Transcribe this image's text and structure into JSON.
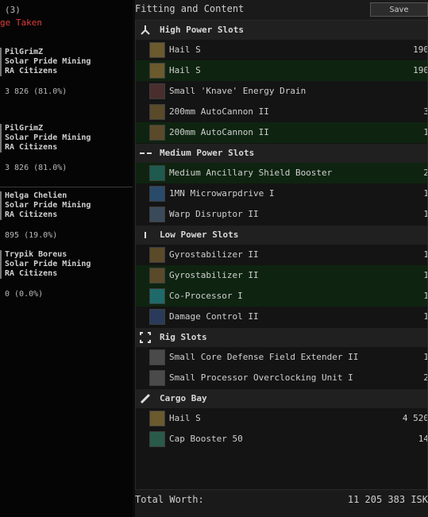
{
  "left_panel": {
    "count": "(3)",
    "damage_label": "ge Taken",
    "entries": [
      {
        "name": "PilGrimZ",
        "corp": "Solar Pride Mining",
        "alliance": "RA Citizens",
        "value": "3 826 (81.0%)"
      },
      {
        "name": "PilGrimZ",
        "corp": "Solar Pride Mining",
        "alliance": "RA Citizens",
        "value": "3 826 (81.0%)"
      },
      {
        "name": "Helga Chelien",
        "corp": "Solar Pride Mining",
        "alliance": "RA Citizens",
        "value": "895 (19.0%)"
      },
      {
        "name": "Trypik Boreus",
        "corp": "Solar Pride Mining",
        "alliance": "RA Citizens",
        "value": "0 (0.0%)"
      }
    ]
  },
  "panel": {
    "title": "Fitting and Content",
    "save_button": "Save Fitting",
    "sections": [
      {
        "label": "High Power Slots",
        "icon": "high-slot-icon",
        "items": [
          {
            "name": "Hail S",
            "qty": "190",
            "icon": "ammo-icon",
            "alt": false
          },
          {
            "name": "Hail S",
            "qty": "190",
            "icon": "ammo-icon",
            "alt": true
          },
          {
            "name": "Small 'Knave' Energy Drain",
            "qty": "",
            "icon": "energy-drain-icon",
            "alt": false
          },
          {
            "name": "200mm AutoCannon II",
            "qty": "3",
            "icon": "autocannon-icon",
            "alt": false
          },
          {
            "name": "200mm AutoCannon II",
            "qty": "1",
            "icon": "autocannon-icon",
            "alt": true
          }
        ]
      },
      {
        "label": "Medium Power Slots",
        "icon": "medium-slot-icon",
        "items": [
          {
            "name": "Medium Ancillary Shield Booster",
            "qty": "2",
            "icon": "shield-booster-icon",
            "alt": true
          },
          {
            "name": "1MN Microwarpdrive I",
            "qty": "1",
            "icon": "microwarpdrive-icon",
            "alt": false
          },
          {
            "name": "Warp Disruptor II",
            "qty": "1",
            "icon": "warp-disruptor-icon",
            "alt": false
          }
        ]
      },
      {
        "label": "Low Power Slots",
        "icon": "low-slot-icon",
        "items": [
          {
            "name": "Gyrostabilizer II",
            "qty": "1",
            "icon": "gyrostabilizer-icon",
            "alt": false
          },
          {
            "name": "Gyrostabilizer II",
            "qty": "1",
            "icon": "gyrostabilizer-icon",
            "alt": true
          },
          {
            "name": "Co-Processor I",
            "qty": "1",
            "icon": "co-processor-icon",
            "alt": true
          },
          {
            "name": "Damage Control II",
            "qty": "1",
            "icon": "damage-control-icon",
            "alt": false
          }
        ]
      },
      {
        "label": "Rig Slots",
        "icon": "rig-slot-icon",
        "items": [
          {
            "name": "Small Core Defense Field Extender II",
            "qty": "1",
            "icon": "rig-icon",
            "alt": false
          },
          {
            "name": "Small Processor Overclocking Unit I",
            "qty": "2",
            "icon": "rig-icon",
            "alt": false
          }
        ]
      },
      {
        "label": "Cargo Bay",
        "icon": "cargo-icon",
        "items": [
          {
            "name": "Hail S",
            "qty": "4 520",
            "icon": "ammo-icon",
            "alt": false
          },
          {
            "name": "Cap Booster 50",
            "qty": "14",
            "icon": "cap-booster-icon",
            "alt": false
          }
        ]
      }
    ],
    "total_label": "Total Worth:",
    "total_value": "11 205 383 ISK"
  },
  "colors": {
    "damage_red": "#e23b3b",
    "row_green": "#0e2410",
    "header_bg": "#202020"
  }
}
